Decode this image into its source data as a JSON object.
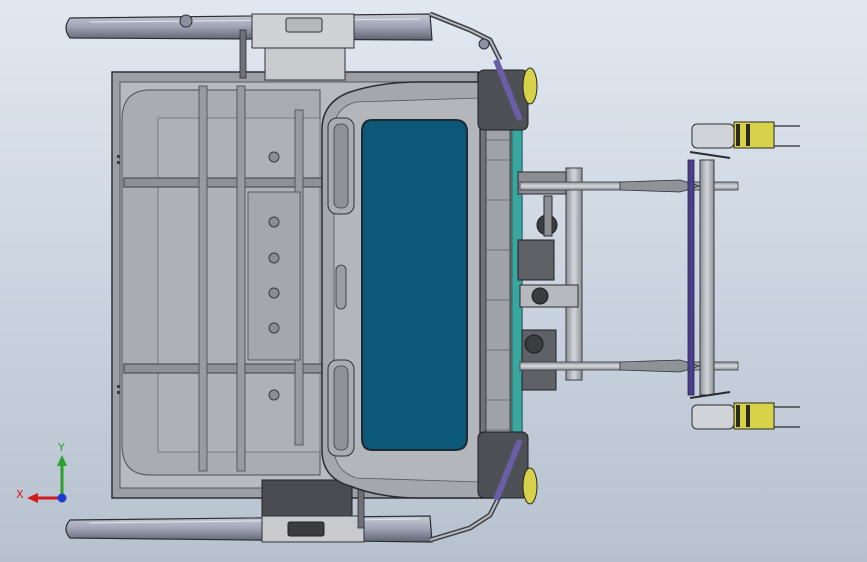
{
  "viewport": {
    "background_top": "#e2e8f1",
    "background_bottom": "#b8c2cf"
  },
  "colors": {
    "frame_grey": "#a9adb2",
    "frame_dark": "#3f4246",
    "panel_blue": "#0b5878",
    "headboard_grey": "#a2a6ab",
    "accent_teal": "#3aa6a0",
    "accent_purple": "#6a5fa6",
    "accent_yellow": "#d8d24a",
    "axis_x": "#d11c1c",
    "axis_y": "#2aa12a",
    "axis_z": "#1c3dd1"
  },
  "triad": {
    "x_label": "X",
    "y_label": "Y",
    "icon": "coordinate-triad-icon"
  }
}
